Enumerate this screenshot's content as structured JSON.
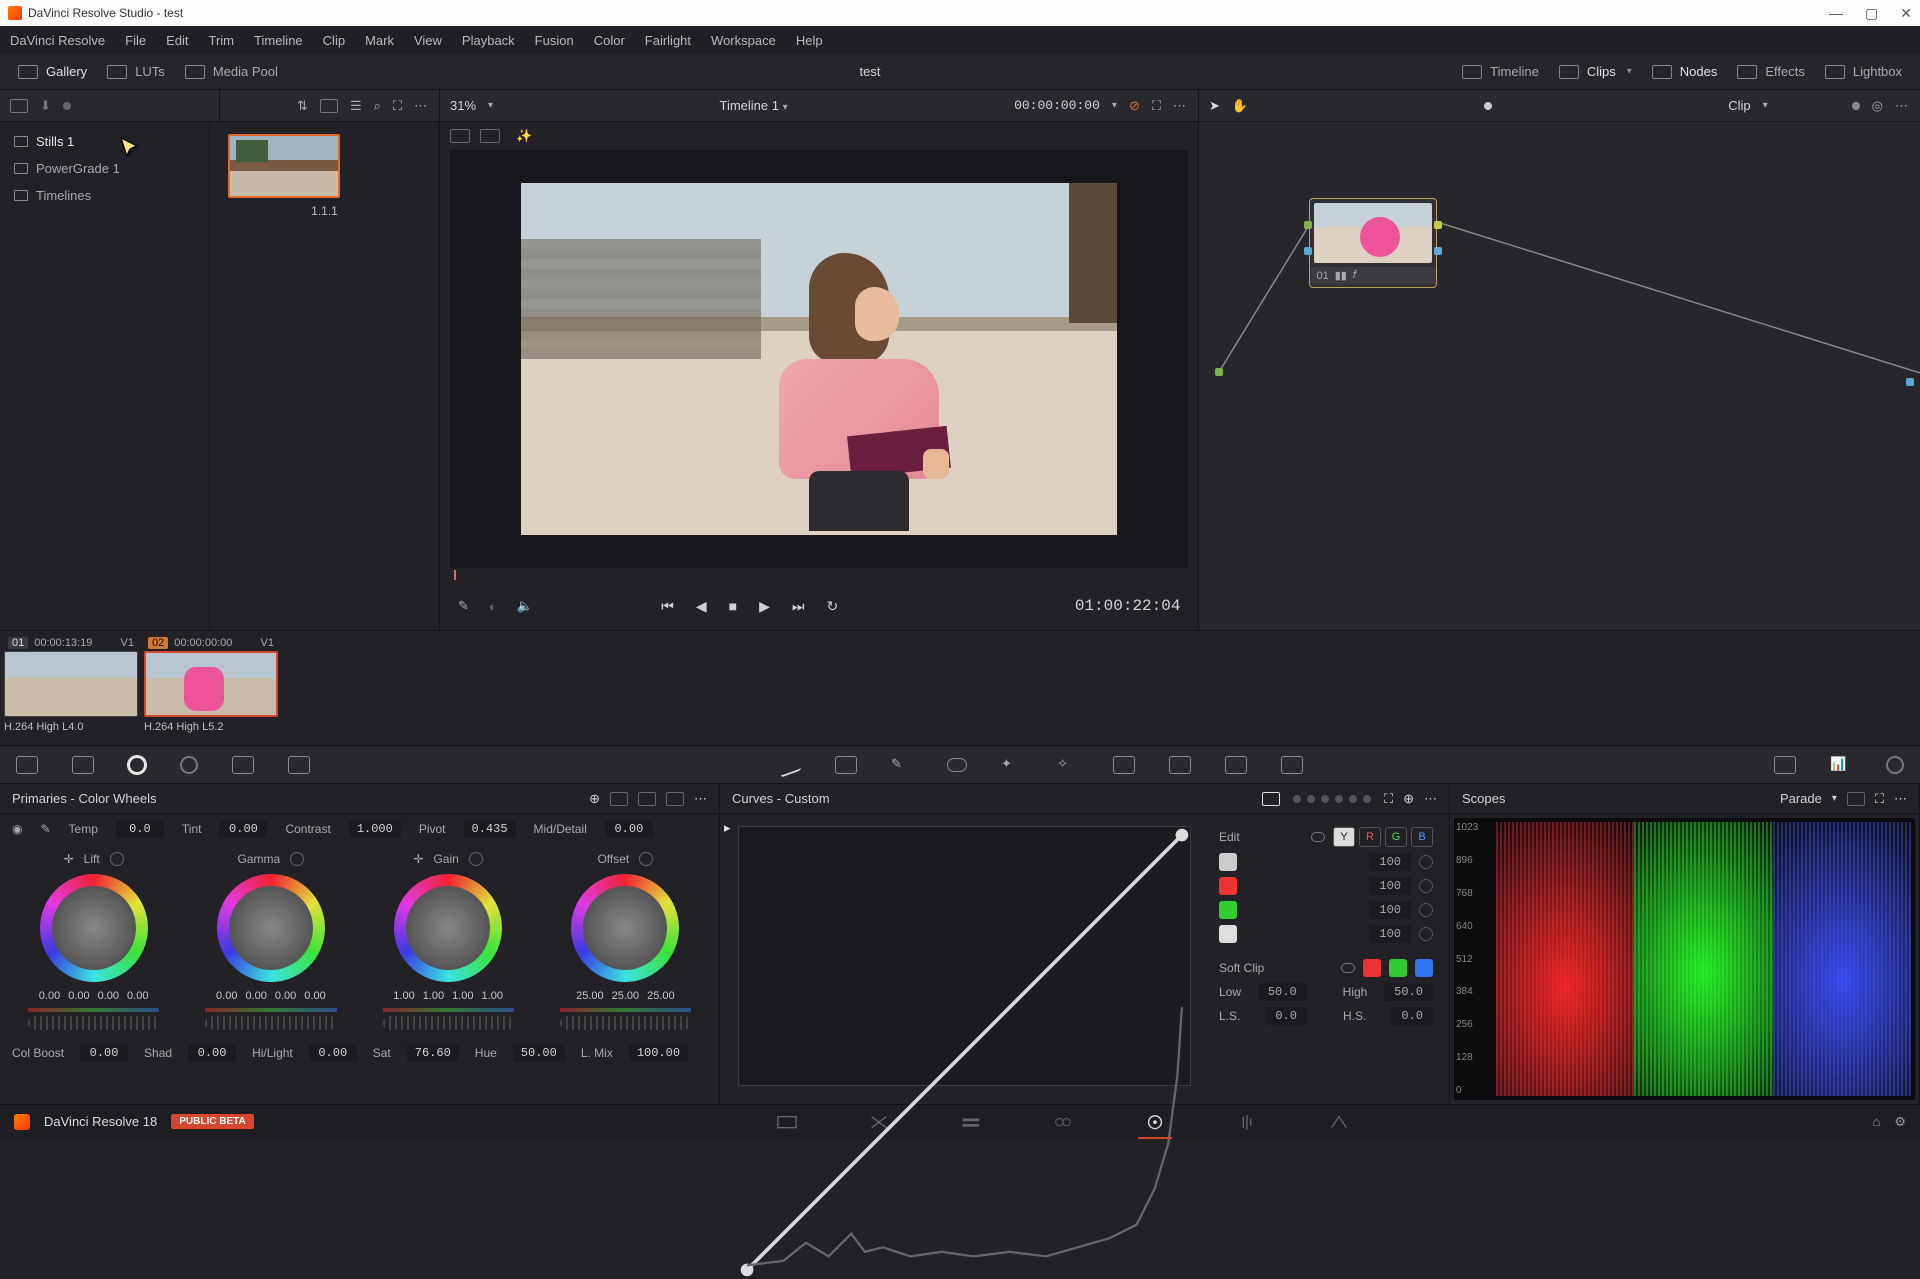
{
  "window": {
    "title": "DaVinci Resolve Studio - test"
  },
  "menu": [
    "DaVinci Resolve",
    "File",
    "Edit",
    "Trim",
    "Timeline",
    "Clip",
    "Mark",
    "View",
    "Playback",
    "Fusion",
    "Color",
    "Fairlight",
    "Workspace",
    "Help"
  ],
  "toptool": {
    "gallery": "Gallery",
    "luts": "LUTs",
    "mediapool": "Media Pool",
    "project": "test",
    "timeline": "Timeline",
    "clips": "Clips",
    "nodes": "Nodes",
    "effects": "Effects",
    "lightbox": "Lightbox"
  },
  "subtool": {
    "zoom": "31%",
    "timeline_name": "Timeline 1",
    "source_tc": "00:00:00:00",
    "node_mode": "Clip"
  },
  "sidebar": {
    "items": [
      "Stills 1",
      "PowerGrade 1",
      "Timelines"
    ]
  },
  "gallery": {
    "thumb_label": "1.1.1"
  },
  "viewer": {
    "tc": "01:00:22:04"
  },
  "node": {
    "id": "01"
  },
  "clips": [
    {
      "num": "01",
      "tc": "00:00:13:19",
      "track": "V1",
      "codec": "H.264 High L4.0"
    },
    {
      "num": "02",
      "tc": "00:00:00:00",
      "track": "V1",
      "codec": "H.264 High L5.2"
    }
  ],
  "primaries": {
    "title": "Primaries - Color Wheels",
    "temp_l": "Temp",
    "temp": "0.0",
    "tint_l": "Tint",
    "tint": "0.00",
    "contrast_l": "Contrast",
    "contrast": "1.000",
    "pivot_l": "Pivot",
    "pivot": "0.435",
    "md_l": "Mid/Detail",
    "md": "0.00",
    "wheels": {
      "lift": {
        "label": "Lift",
        "v": [
          "0.00",
          "0.00",
          "0.00",
          "0.00"
        ]
      },
      "gamma": {
        "label": "Gamma",
        "v": [
          "0.00",
          "0.00",
          "0.00",
          "0.00"
        ]
      },
      "gain": {
        "label": "Gain",
        "v": [
          "1.00",
          "1.00",
          "1.00",
          "1.00"
        ]
      },
      "offset": {
        "label": "Offset",
        "v": [
          "25.00",
          "25.00",
          "25.00"
        ]
      }
    },
    "colboost_l": "Col Boost",
    "colboost": "0.00",
    "shad_l": "Shad",
    "shad": "0.00",
    "hilite_l": "Hi/Light",
    "hilite": "0.00",
    "sat_l": "Sat",
    "sat": "76.60",
    "hue_l": "Hue",
    "hue": "50.00",
    "lmix_l": "L. Mix",
    "lmix": "100.00"
  },
  "curves": {
    "title": "Curves - Custom",
    "edit": "Edit",
    "y": "Y",
    "r": "R",
    "g": "G",
    "b": "B",
    "intensity": {
      "lum": "100",
      "red": "100",
      "green": "100",
      "blue": "100"
    },
    "softclip": "Soft Clip",
    "low_l": "Low",
    "low": "50.0",
    "high_l": "High",
    "high": "50.0",
    "ls_l": "L.S.",
    "ls": "0.0",
    "hs_l": "H.S.",
    "hs": "0.0"
  },
  "scopes": {
    "title": "Scopes",
    "mode": "Parade",
    "ticks": [
      "1023",
      "896",
      "768",
      "640",
      "512",
      "384",
      "256",
      "128",
      "0"
    ]
  },
  "footer": {
    "version": "DaVinci Resolve 18",
    "beta": "PUBLIC BETA"
  }
}
